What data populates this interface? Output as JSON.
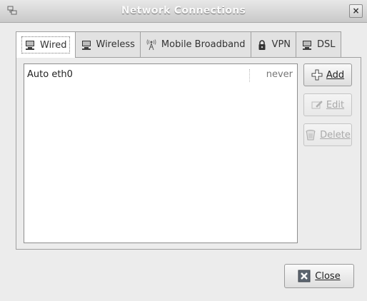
{
  "window": {
    "title": "Network Connections",
    "close_glyph": "×"
  },
  "tabs": [
    {
      "label": "Wired",
      "icon": "wired-network-icon",
      "active": true
    },
    {
      "label": "Wireless",
      "icon": "wireless-icon",
      "active": false
    },
    {
      "label": "Mobile Broadband",
      "icon": "mobile-broadband-tower-icon",
      "active": false
    },
    {
      "label": "VPN",
      "icon": "vpn-lock-icon",
      "active": false
    },
    {
      "label": "DSL",
      "icon": "dsl-icon",
      "active": false
    }
  ],
  "connections": [
    {
      "name": "Auto eth0",
      "last_used": "never"
    }
  ],
  "side_buttons": {
    "add": {
      "label": "Add",
      "icon": "add-icon",
      "enabled": true
    },
    "edit": {
      "label": "Edit",
      "icon": "edit-icon",
      "enabled": false
    },
    "delete": {
      "label": "Delete",
      "icon": "delete-trash-icon",
      "enabled": false
    }
  },
  "footer": {
    "close_label": "Close",
    "close_icon": "close-icon"
  }
}
